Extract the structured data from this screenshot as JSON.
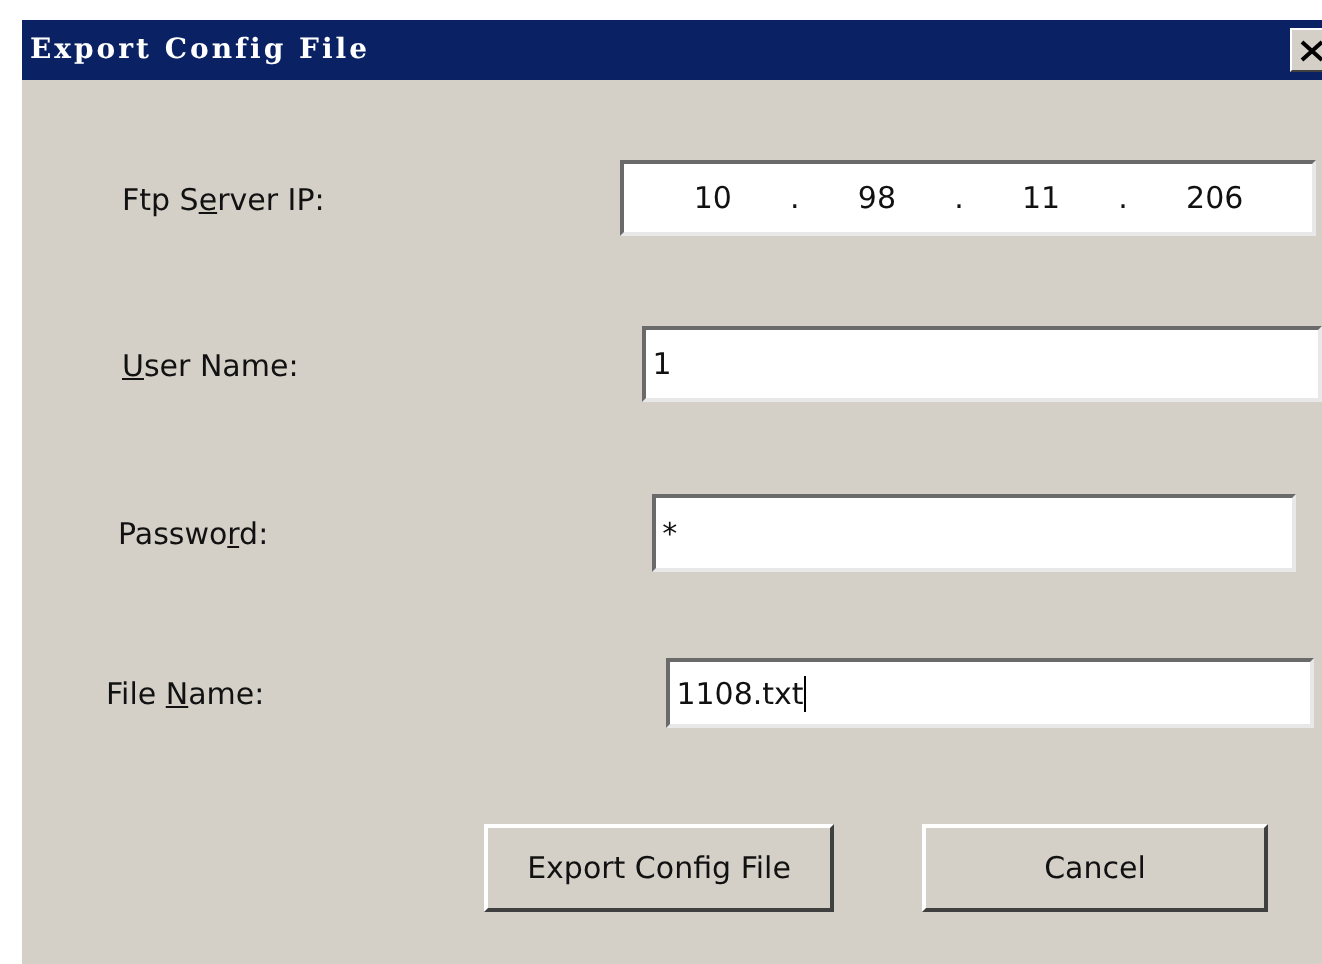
{
  "window": {
    "title": "Export Config File"
  },
  "fields": [
    {
      "kind": "ip",
      "label": {
        "pre": "Ftp S",
        "key": "e",
        "post": "rver IP:"
      },
      "octets": [
        "10",
        "98",
        "11",
        "206"
      ],
      "separator": "."
    },
    {
      "kind": "text",
      "label": {
        "key": "U",
        "post": "ser Name:"
      },
      "value": "1",
      "focused": false
    },
    {
      "kind": "text",
      "label": {
        "pre": "Passwo",
        "key": "r",
        "post": "d:"
      },
      "value": "*",
      "focused": false
    },
    {
      "kind": "text",
      "label": {
        "pre": "File ",
        "key": "N",
        "post": "ame:"
      },
      "value": "1108.txt",
      "focused": true
    }
  ],
  "buttons": [
    "Export Config File",
    "Cancel"
  ]
}
